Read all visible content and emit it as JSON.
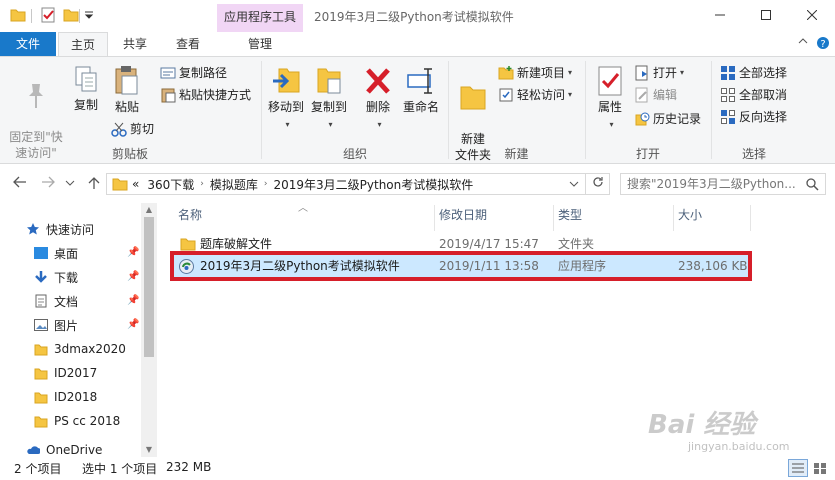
{
  "window": {
    "context_tab": "应用程序工具",
    "title": "2019年3月二级Python考试模拟软件"
  },
  "tabs": {
    "file": "文件",
    "home": "主页",
    "share": "共享",
    "view": "查看",
    "manage": "管理"
  },
  "ribbon": {
    "clipboard": {
      "label": "剪贴板",
      "pin_quick_access": "固定到\"快\n速访问\"",
      "copy": "复制",
      "paste": "粘贴",
      "copy_path": "复制路径",
      "paste_shortcut": "粘贴快捷方式",
      "cut": "剪切"
    },
    "organize": {
      "label": "组织",
      "move_to": "移动到",
      "copy_to": "复制到",
      "delete": "删除",
      "rename": "重命名"
    },
    "new": {
      "label": "新建",
      "new_folder": "新建\n文件夹",
      "new_item": "新建项目",
      "easy_access": "轻松访问"
    },
    "open": {
      "label": "打开",
      "properties": "属性",
      "open": "打开",
      "edit": "编辑",
      "history": "历史记录"
    },
    "select": {
      "label": "选择",
      "select_all": "全部选择",
      "select_none": "全部取消",
      "invert": "反向选择"
    }
  },
  "address": {
    "overflow": "«",
    "crumbs": [
      "360下载",
      "模拟题库",
      "2019年3月二级Python考试模拟软件"
    ],
    "search_placeholder": "搜索\"2019年3月二级Python..."
  },
  "nav": {
    "quick_access": "快速访问",
    "items": [
      "桌面",
      "下载",
      "文档",
      "图片",
      "3dmax2020",
      "ID2017",
      "ID2018",
      "PS cc 2018"
    ],
    "onedrive": "OneDrive"
  },
  "columns": {
    "name": "名称",
    "modified": "修改日期",
    "type": "类型",
    "size": "大小"
  },
  "files": [
    {
      "name": "题库破解文件",
      "modified": "2019/4/17 15:47",
      "type": "文件夹",
      "size": ""
    },
    {
      "name": "2019年3月二级Python考试模拟软件",
      "modified": "2019/1/11 13:58",
      "type": "应用程序",
      "size": "238,106 KB"
    }
  ],
  "status": {
    "count": "2 个项目",
    "selected": "选中 1 个项目",
    "size": "232 MB"
  },
  "watermark": {
    "main": "Bai 经验",
    "sub": "jingyan.baidu.com"
  },
  "colors": {
    "accent": "#1979ca",
    "context_tab": "#f1d6f5",
    "selection": "#cce8ff",
    "highlight_border": "#d61f2a",
    "folder": "#f5c542"
  }
}
